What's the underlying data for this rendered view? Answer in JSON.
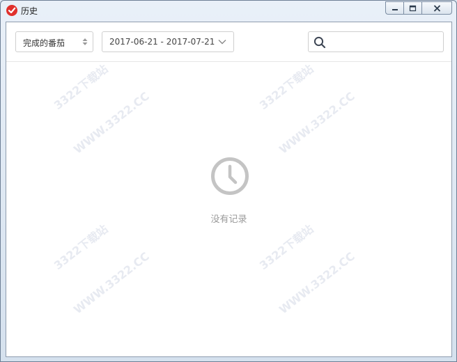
{
  "window": {
    "title": "历史"
  },
  "toolbar": {
    "status_select": {
      "value": "完成的番茄"
    },
    "date_range": {
      "value": "2017-06-21 - 2017-07-21"
    },
    "search": {
      "value": "",
      "placeholder": ""
    }
  },
  "empty_state": {
    "message": "没有记录"
  },
  "watermarks": [
    "3322下载站",
    "WWW.3322.CC",
    "3322下载站",
    "WWW.3322.CC",
    "3322下载站",
    "WWW.3322.CC",
    "3322下载站",
    "WWW.3322.CC"
  ],
  "colors": {
    "brand": "#e0302c",
    "empty_icon": "#c4c4c4",
    "empty_text": "#9a9a9a"
  },
  "icons": {
    "app": "tomato-check-icon",
    "search": "search-icon",
    "empty": "clock-icon"
  }
}
